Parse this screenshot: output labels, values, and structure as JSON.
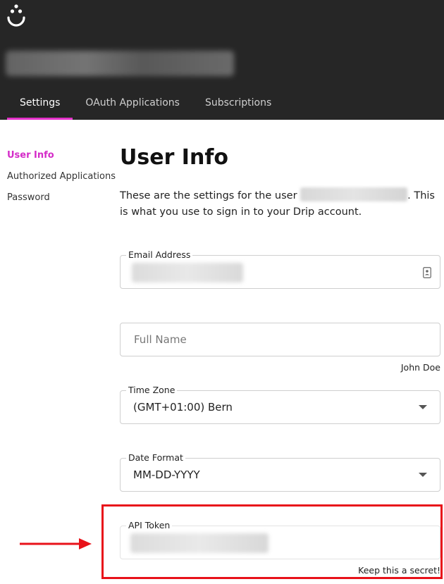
{
  "header": {
    "logo_icon": "drip-droplet-smile-icon",
    "tabs": [
      {
        "label": "Settings",
        "active": true
      },
      {
        "label": "OAuth Applications",
        "active": false
      },
      {
        "label": "Subscriptions",
        "active": false
      }
    ]
  },
  "sidebar": {
    "items": [
      {
        "label": "User Info",
        "active": true
      },
      {
        "label": "Authorized Applications",
        "active": false
      },
      {
        "label": "Password",
        "active": false
      }
    ]
  },
  "main": {
    "title": "User Info",
    "intro_before": "These are the settings for the user",
    "intro_after": ". This is what you use to sign in to your Drip account.",
    "fields": {
      "email": {
        "label": "Email Address",
        "icon": "contact-card-icon"
      },
      "full_name": {
        "placeholder": "Full Name",
        "helper": "John Doe"
      },
      "time_zone": {
        "label": "Time Zone",
        "value": "(GMT+01:00) Bern"
      },
      "date_format": {
        "label": "Date Format",
        "value": "MM-DD-YYYY"
      },
      "api_token": {
        "label": "API Token",
        "helper": "Keep this a secret!"
      }
    }
  },
  "colors": {
    "accent": "#e431c9",
    "header_bg": "#262626",
    "annotation": "#e8121a"
  }
}
